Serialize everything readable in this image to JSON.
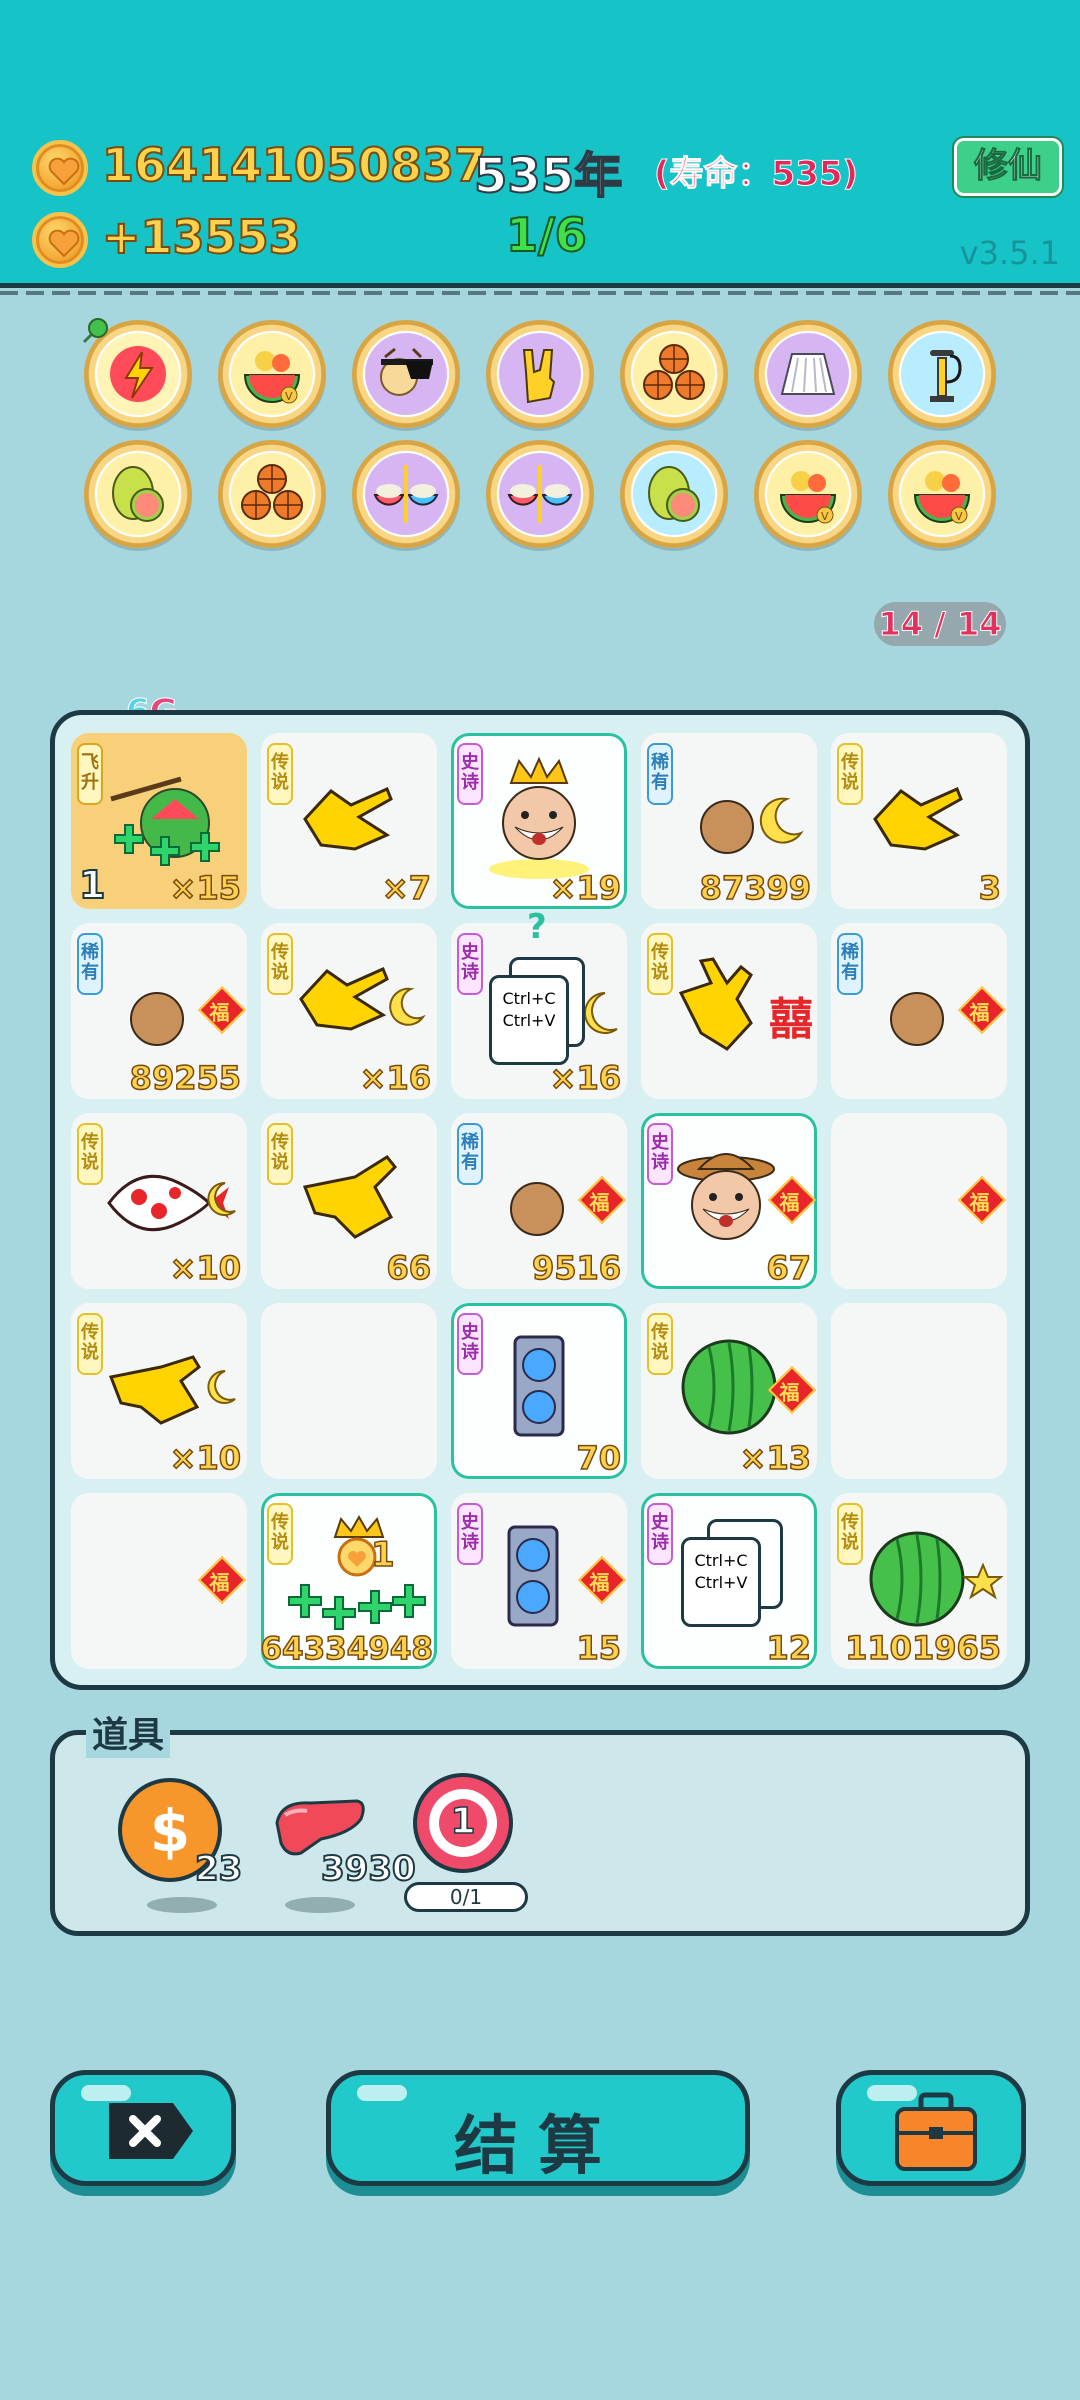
{
  "header": {
    "coins": "164141050837",
    "income": "+13553",
    "year": "535年",
    "lifespan": "(寿命：535)",
    "progress": "1/6",
    "cultivate_button": "修仙",
    "version": "v3.5.1"
  },
  "badges_row1": [
    "lightning-icon",
    "fruit-basket-icon",
    "fruit-basket-icon",
    "rock-hand-icon",
    "basketball-trio-icon",
    "skirt-icon",
    "pump-icon"
  ],
  "badges_row2": [
    "pomelo-icon",
    "basketball-trio-icon",
    "rice-bowls-icon",
    "rice-bowls-icon",
    "pomelo-icon",
    "fruit-basket-icon",
    "fruit-basket-icon"
  ],
  "slot_count": "14 / 14",
  "board": {
    "label_num": "6",
    "label_letter": "G",
    "cells": [
      {
        "tag": "飞升",
        "count": "×15",
        "corner": "1"
      },
      {
        "tag": "传说",
        "count": "×7"
      },
      {
        "tag": "史诗",
        "count": "×19"
      },
      {
        "tag": "稀有",
        "count": "87399"
      },
      {
        "tag": "传说",
        "count": "3"
      },
      {
        "tag": "稀有",
        "count": "89255",
        "fu": "福"
      },
      {
        "tag": "传说",
        "count": "×16"
      },
      {
        "tag": "史诗",
        "count": "×16",
        "card_line1": "Ctrl+C",
        "card_line2": "Ctrl+V",
        "question": "?"
      },
      {
        "tag": "传说",
        "count": "",
        "xi": "囍"
      },
      {
        "tag": "稀有",
        "count": "",
        "fu": "福"
      },
      {
        "tag": "传说",
        "count": "×10"
      },
      {
        "tag": "传说",
        "count": "66"
      },
      {
        "tag": "稀有",
        "count": "9516",
        "fu": "福"
      },
      {
        "tag": "史诗",
        "count": "67",
        "fu": "福"
      },
      {
        "tag": "",
        "count": "",
        "fu": "福"
      },
      {
        "tag": "传说",
        "count": "×10"
      },
      {
        "tag": "",
        "count": ""
      },
      {
        "tag": "史诗",
        "count": "70"
      },
      {
        "tag": "传说",
        "count": "×13",
        "fu": "福"
      },
      {
        "tag": "",
        "count": ""
      },
      {
        "tag": "",
        "count": "",
        "fu": "福"
      },
      {
        "tag": "传说",
        "count": "64334948",
        "corner": "1"
      },
      {
        "tag": "史诗",
        "count": "15",
        "fu": "福"
      },
      {
        "tag": "史诗",
        "count": "12",
        "card_line1": "Ctrl+C",
        "card_line2": "Ctrl+V"
      },
      {
        "tag": "传说",
        "count": "1101965"
      }
    ]
  },
  "props": {
    "title": "道具",
    "items": [
      {
        "icon": "dollar-coin-icon",
        "value": "23"
      },
      {
        "icon": "liver-icon",
        "value": "3930"
      },
      {
        "icon": "target-icon",
        "value": "1",
        "bar": "0/1"
      }
    ]
  },
  "buttons": {
    "exit_icon": "exit-x-icon",
    "settle": "结算",
    "bag_icon": "briefcase-icon"
  },
  "colors": {
    "header_bg": "#16c3c6",
    "page_bg": "#a6d7de",
    "gold_text": "#fbd24e",
    "button_bg": "#22c9cb"
  }
}
